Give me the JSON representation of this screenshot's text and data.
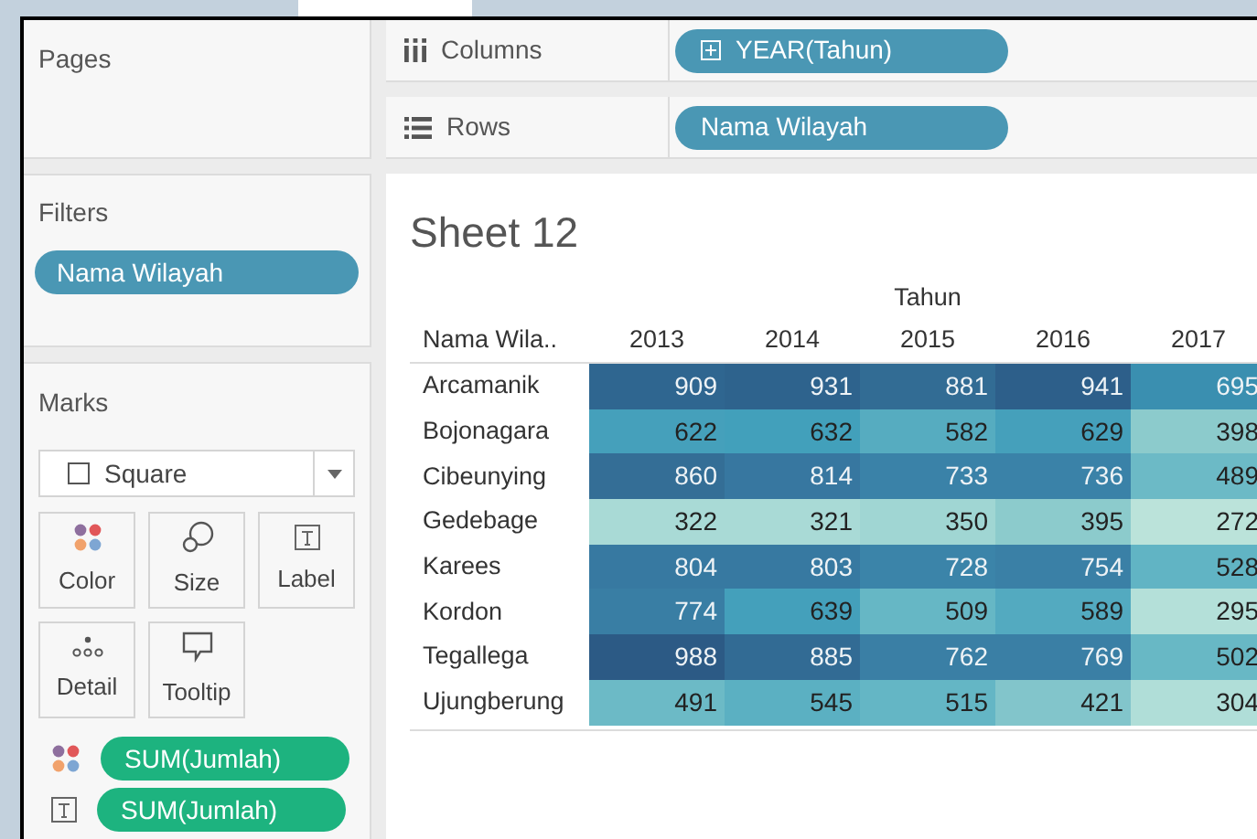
{
  "pages": {
    "title": "Pages"
  },
  "filters": {
    "title": "Filters",
    "pills": [
      "Nama Wilayah"
    ]
  },
  "marks": {
    "title": "Marks",
    "mark_type": "Square",
    "buttons": [
      {
        "kind": "color",
        "label": "Color"
      },
      {
        "kind": "size",
        "label": "Size"
      },
      {
        "kind": "label",
        "label": "Label"
      },
      {
        "kind": "detail",
        "label": "Detail"
      },
      {
        "kind": "tooltip",
        "label": "Tooltip"
      }
    ],
    "fields": [
      {
        "kind": "color",
        "label": "SUM(Jumlah)"
      },
      {
        "kind": "label",
        "label": "SUM(Jumlah)"
      }
    ]
  },
  "columns_shelf": {
    "label": "Columns",
    "pills": [
      {
        "expand_icon": true,
        "label": "YEAR(Tahun)"
      }
    ]
  },
  "rows_shelf": {
    "label": "Rows",
    "pills": [
      {
        "label": "Nama Wilayah"
      }
    ]
  },
  "sheet": {
    "title": "Sheet 12",
    "column_group": "Tahun",
    "row_header": "Nama Wila..",
    "years": [
      "2013",
      "2014",
      "2015",
      "2016",
      "2017"
    ],
    "rows": [
      {
        "name": "Arcamanik",
        "cells": [
          {
            "value": "909",
            "color": "#2f6690"
          },
          {
            "value": "931",
            "color": "#2e638d"
          },
          {
            "value": "881",
            "color": "#326c94"
          },
          {
            "value": "941",
            "color": "#2d5f8a"
          },
          {
            "value": "695",
            "color": "#3a8fb0"
          }
        ]
      },
      {
        "name": "Bojonagara",
        "cells": [
          {
            "value": "622",
            "color": "#45a0bb"
          },
          {
            "value": "632",
            "color": "#42a0bb"
          },
          {
            "value": "582",
            "color": "#56acc0"
          },
          {
            "value": "629",
            "color": "#45a0bb"
          },
          {
            "value": "398",
            "color": "#8ccbcc"
          }
        ]
      },
      {
        "name": "Cibeunying",
        "cells": [
          {
            "value": "860",
            "color": "#346e96"
          },
          {
            "value": "814",
            "color": "#3777a0"
          },
          {
            "value": "733",
            "color": "#3a82a8"
          },
          {
            "value": "736",
            "color": "#3a82a8"
          },
          {
            "value": "489",
            "color": "#6cbac6"
          }
        ]
      },
      {
        "name": "Gedebage",
        "cells": [
          {
            "value": "322",
            "color": "#a9dad6"
          },
          {
            "value": "321",
            "color": "#a9dad6"
          },
          {
            "value": "350",
            "color": "#a0d6d3"
          },
          {
            "value": "395",
            "color": "#8ccbcc"
          },
          {
            "value": "272",
            "color": "#bbe3da"
          }
        ]
      },
      {
        "name": "Karees",
        "cells": [
          {
            "value": "804",
            "color": "#3779a1"
          },
          {
            "value": "803",
            "color": "#3779a1"
          },
          {
            "value": "728",
            "color": "#3b84a9"
          },
          {
            "value": "754",
            "color": "#3a80a6"
          },
          {
            "value": "528",
            "color": "#61b4c4"
          }
        ]
      },
      {
        "name": "Kordon",
        "cells": [
          {
            "value": "774",
            "color": "#397ea4"
          },
          {
            "value": "639",
            "color": "#44a0bb"
          },
          {
            "value": "509",
            "color": "#66b7c5"
          },
          {
            "value": "589",
            "color": "#53aac0"
          },
          {
            "value": "295",
            "color": "#b4e0d9"
          }
        ]
      },
      {
        "name": "Tegallega",
        "cells": [
          {
            "value": "988",
            "color": "#2c5a85"
          },
          {
            "value": "885",
            "color": "#326b94"
          },
          {
            "value": "762",
            "color": "#3a7fa5"
          },
          {
            "value": "769",
            "color": "#3a7fa5"
          },
          {
            "value": "502",
            "color": "#68b8c5"
          }
        ]
      },
      {
        "name": "Ujungberung",
        "cells": [
          {
            "value": "491",
            "color": "#6cbac6"
          },
          {
            "value": "545",
            "color": "#5bb0c2"
          },
          {
            "value": "515",
            "color": "#64b6c5"
          },
          {
            "value": "421",
            "color": "#82c5cb"
          },
          {
            "value": "304",
            "color": "#b0ded8"
          }
        ]
      }
    ]
  }
}
